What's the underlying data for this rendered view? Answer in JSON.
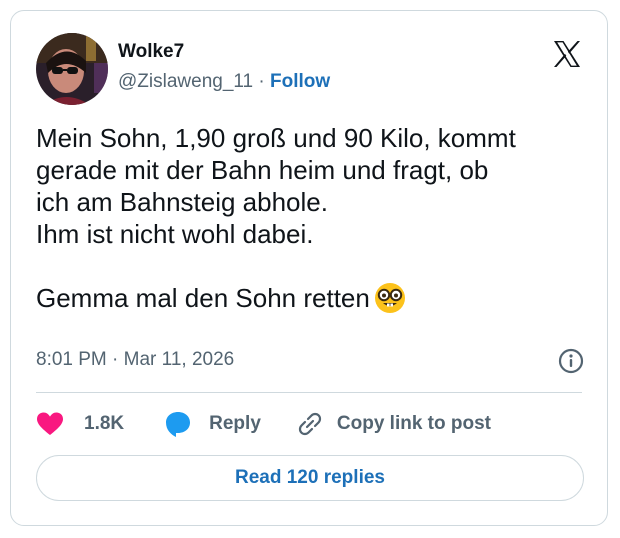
{
  "author": {
    "name": "Wolke7",
    "handle": "@Zislaweng_11",
    "separator": "·",
    "follow_label": "Follow"
  },
  "post": {
    "lines": [
      "Mein Sohn, 1,90 groß und 90 Kilo, kommt",
      "gerade mit der Bahn heim und fragt, ob",
      "ich am Bahnsteig abhole.",
      "Ihm ist nicht wohl dabei."
    ],
    "closing": "Gemma mal den Sohn retten",
    "closing_emoji": "nerd-face-icon"
  },
  "meta": {
    "time": "8:01 PM",
    "separator": "·",
    "date": "Mar 11, 2026"
  },
  "actions": {
    "like_count": "1.8K",
    "reply_label": "Reply",
    "copy_label": "Copy link to post"
  },
  "footer": {
    "read_replies_label": "Read 120 replies"
  },
  "colors": {
    "like": "#f91880",
    "reply": "#1d9bf0",
    "follow": "#1d70b8",
    "muted": "#536471",
    "border": "#cfd9de"
  },
  "icons": [
    "x-logo-icon",
    "heart-icon",
    "reply-bubble-icon",
    "link-icon",
    "info-icon",
    "nerd-face-icon"
  ]
}
